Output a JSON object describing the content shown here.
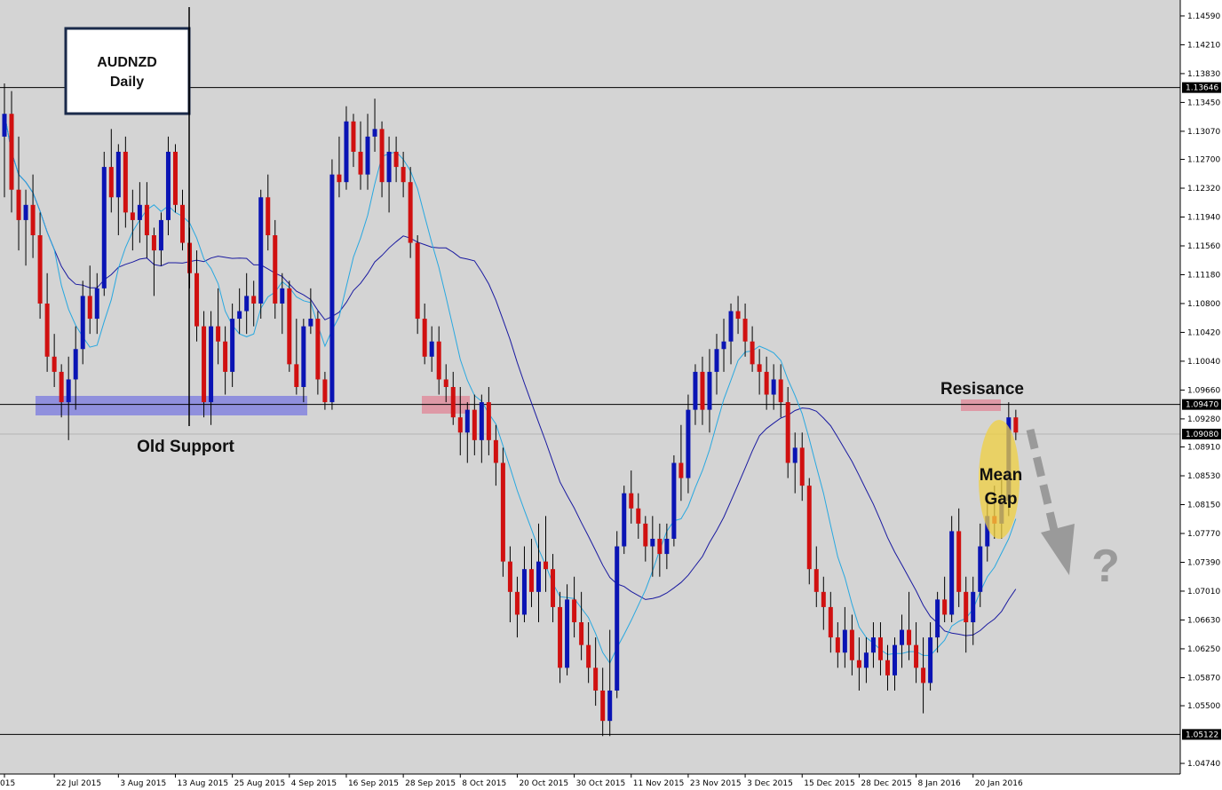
{
  "chart_data": {
    "type": "candlestick",
    "title": "AUDNZD",
    "subtitle": "Daily",
    "ylim": [
      1.046,
      1.148
    ],
    "y_ticks": [
      1.1459,
      1.1421,
      1.1383,
      1.1345,
      1.1307,
      1.127,
      1.1232,
      1.1194,
      1.1156,
      1.1118,
      1.108,
      1.1042,
      1.1004,
      1.0966,
      1.0928,
      1.0891,
      1.0853,
      1.0815,
      1.0777,
      1.0739,
      1.0701,
      1.0663,
      1.0625,
      1.0587,
      1.055,
      1.0474
    ],
    "y_tick_labels": [
      "1.14590",
      "1.14210",
      "1.13830",
      "1.13450",
      "1.13070",
      "1.12700",
      "1.12320",
      "1.11940",
      "1.11560",
      "1.11180",
      "1.10800",
      "1.10420",
      "1.10040",
      "1.09660",
      "1.09280",
      "1.08910",
      "1.08530",
      "1.08150",
      "1.07770",
      "1.07390",
      "1.07010",
      "1.06630",
      "1.06250",
      "1.05870",
      "1.05500",
      "1.04740"
    ],
    "x_labels": [
      {
        "label": "015",
        "bar": 0
      },
      {
        "label": "22 Jul 2015",
        "bar": 7
      },
      {
        "label": "3 Aug 2015",
        "bar": 16
      },
      {
        "label": "13 Aug 2015",
        "bar": 24
      },
      {
        "label": "25 Aug 2015",
        "bar": 32
      },
      {
        "label": "4 Sep 2015",
        "bar": 40
      },
      {
        "label": "16 Sep 2015",
        "bar": 48
      },
      {
        "label": "28 Sep 2015",
        "bar": 56
      },
      {
        "label": "8 Oct 2015",
        "bar": 64
      },
      {
        "label": "20 Oct 2015",
        "bar": 72
      },
      {
        "label": "30 Oct 2015",
        "bar": 80
      },
      {
        "label": "11 Nov 2015",
        "bar": 88
      },
      {
        "label": "23 Nov 2015",
        "bar": 96
      },
      {
        "label": "3 Dec 2015",
        "bar": 104
      },
      {
        "label": "15 Dec 2015",
        "bar": 112
      },
      {
        "label": "28 Dec 2015",
        "bar": 120
      },
      {
        "label": "8 Jan 2016",
        "bar": 128
      },
      {
        "label": "20 Jan 2016",
        "bar": 136
      }
    ],
    "horizontal_lines": [
      {
        "price": 1.13646,
        "label": "1.13646"
      },
      {
        "price": 1.0947,
        "label": "1.09470"
      },
      {
        "price": 1.0908,
        "label": "1.09080"
      },
      {
        "price": 1.05122,
        "label": "1.05122"
      }
    ],
    "bull_color": "#0a14b4",
    "bear_color": "#d01010",
    "ma_fast_color": "#28a8e0",
    "ma_slow_color": "#1a1aa0",
    "ohlc": [
      [
        1.13,
        1.137,
        1.122,
        1.133
      ],
      [
        1.133,
        1.136,
        1.12,
        1.123
      ],
      [
        1.123,
        1.13,
        1.115,
        1.119
      ],
      [
        1.119,
        1.123,
        1.113,
        1.121
      ],
      [
        1.121,
        1.125,
        1.114,
        1.117
      ],
      [
        1.117,
        1.12,
        1.106,
        1.108
      ],
      [
        1.108,
        1.112,
        1.099,
        1.101
      ],
      [
        1.101,
        1.104,
        1.097,
        1.099
      ],
      [
        1.099,
        1.1,
        1.093,
        1.095
      ],
      [
        1.095,
        1.101,
        1.09,
        1.098
      ],
      [
        1.098,
        1.105,
        1.094,
        1.102
      ],
      [
        1.102,
        1.111,
        1.1,
        1.109
      ],
      [
        1.109,
        1.113,
        1.104,
        1.106
      ],
      [
        1.106,
        1.112,
        1.104,
        1.11
      ],
      [
        1.11,
        1.128,
        1.109,
        1.126
      ],
      [
        1.126,
        1.131,
        1.12,
        1.122
      ],
      [
        1.122,
        1.129,
        1.117,
        1.128
      ],
      [
        1.128,
        1.13,
        1.118,
        1.12
      ],
      [
        1.12,
        1.123,
        1.115,
        1.119
      ],
      [
        1.119,
        1.124,
        1.116,
        1.121
      ],
      [
        1.121,
        1.124,
        1.114,
        1.117
      ],
      [
        1.117,
        1.118,
        1.109,
        1.115
      ],
      [
        1.115,
        1.12,
        1.113,
        1.119
      ],
      [
        1.119,
        1.13,
        1.117,
        1.128
      ],
      [
        1.128,
        1.129,
        1.12,
        1.121
      ],
      [
        1.121,
        1.123,
        1.115,
        1.116
      ],
      [
        1.116,
        1.118,
        1.11,
        1.112
      ],
      [
        1.112,
        1.115,
        1.103,
        1.105
      ],
      [
        1.105,
        1.107,
        1.093,
        1.095
      ],
      [
        1.095,
        1.107,
        1.092,
        1.105
      ],
      [
        1.105,
        1.11,
        1.1,
        1.103
      ],
      [
        1.103,
        1.105,
        1.096,
        1.099
      ],
      [
        1.099,
        1.108,
        1.097,
        1.106
      ],
      [
        1.106,
        1.11,
        1.104,
        1.107
      ],
      [
        1.107,
        1.112,
        1.104,
        1.109
      ],
      [
        1.109,
        1.111,
        1.105,
        1.108
      ],
      [
        1.108,
        1.123,
        1.106,
        1.122
      ],
      [
        1.122,
        1.125,
        1.115,
        1.117
      ],
      [
        1.117,
        1.119,
        1.106,
        1.108
      ],
      [
        1.108,
        1.112,
        1.104,
        1.11
      ],
      [
        1.11,
        1.111,
        1.099,
        1.1
      ],
      [
        1.1,
        1.106,
        1.096,
        1.097
      ],
      [
        1.097,
        1.106,
        1.095,
        1.105
      ],
      [
        1.105,
        1.11,
        1.104,
        1.106
      ],
      [
        1.106,
        1.107,
        1.096,
        1.098
      ],
      [
        1.098,
        1.099,
        1.094,
        1.095
      ],
      [
        1.095,
        1.127,
        1.094,
        1.125
      ],
      [
        1.125,
        1.13,
        1.122,
        1.124
      ],
      [
        1.124,
        1.134,
        1.123,
        1.132
      ],
      [
        1.132,
        1.133,
        1.126,
        1.128
      ],
      [
        1.128,
        1.132,
        1.123,
        1.125
      ],
      [
        1.125,
        1.133,
        1.123,
        1.13
      ],
      [
        1.13,
        1.135,
        1.128,
        1.131
      ],
      [
        1.131,
        1.132,
        1.122,
        1.124
      ],
      [
        1.124,
        1.13,
        1.12,
        1.128
      ],
      [
        1.128,
        1.13,
        1.124,
        1.126
      ],
      [
        1.126,
        1.128,
        1.122,
        1.124
      ],
      [
        1.124,
        1.126,
        1.114,
        1.116
      ],
      [
        1.116,
        1.117,
        1.104,
        1.106
      ],
      [
        1.106,
        1.108,
        1.1,
        1.101
      ],
      [
        1.101,
        1.105,
        1.099,
        1.103
      ],
      [
        1.103,
        1.105,
        1.096,
        1.098
      ],
      [
        1.098,
        1.1,
        1.095,
        1.097
      ],
      [
        1.097,
        1.099,
        1.092,
        1.093
      ],
      [
        1.093,
        1.097,
        1.088,
        1.091
      ],
      [
        1.091,
        1.095,
        1.087,
        1.094
      ],
      [
        1.094,
        1.096,
        1.088,
        1.09
      ],
      [
        1.09,
        1.096,
        1.087,
        1.095
      ],
      [
        1.095,
        1.097,
        1.088,
        1.09
      ],
      [
        1.09,
        1.092,
        1.084,
        1.087
      ],
      [
        1.087,
        1.089,
        1.072,
        1.074
      ],
      [
        1.074,
        1.076,
        1.066,
        1.07
      ],
      [
        1.07,
        1.072,
        1.064,
        1.067
      ],
      [
        1.067,
        1.076,
        1.066,
        1.073
      ],
      [
        1.073,
        1.077,
        1.068,
        1.07
      ],
      [
        1.07,
        1.079,
        1.066,
        1.074
      ],
      [
        1.074,
        1.08,
        1.07,
        1.073
      ],
      [
        1.073,
        1.075,
        1.066,
        1.068
      ],
      [
        1.068,
        1.07,
        1.058,
        1.06
      ],
      [
        1.06,
        1.071,
        1.059,
        1.069
      ],
      [
        1.069,
        1.072,
        1.064,
        1.066
      ],
      [
        1.066,
        1.07,
        1.061,
        1.063
      ],
      [
        1.063,
        1.066,
        1.058,
        1.06
      ],
      [
        1.06,
        1.064,
        1.055,
        1.057
      ],
      [
        1.057,
        1.06,
        1.051,
        1.053
      ],
      [
        1.053,
        1.065,
        1.051,
        1.057
      ],
      [
        1.057,
        1.078,
        1.056,
        1.076
      ],
      [
        1.076,
        1.084,
        1.075,
        1.083
      ],
      [
        1.083,
        1.086,
        1.079,
        1.081
      ],
      [
        1.081,
        1.083,
        1.077,
        1.079
      ],
      [
        1.079,
        1.08,
        1.074,
        1.076
      ],
      [
        1.076,
        1.08,
        1.072,
        1.077
      ],
      [
        1.077,
        1.079,
        1.072,
        1.075
      ],
      [
        1.075,
        1.079,
        1.073,
        1.077
      ],
      [
        1.077,
        1.088,
        1.076,
        1.087
      ],
      [
        1.087,
        1.092,
        1.082,
        1.085
      ],
      [
        1.085,
        1.096,
        1.083,
        1.094
      ],
      [
        1.094,
        1.1,
        1.092,
        1.099
      ],
      [
        1.099,
        1.101,
        1.092,
        1.094
      ],
      [
        1.094,
        1.102,
        1.091,
        1.099
      ],
      [
        1.099,
        1.104,
        1.096,
        1.102
      ],
      [
        1.102,
        1.106,
        1.099,
        1.103
      ],
      [
        1.103,
        1.108,
        1.1,
        1.107
      ],
      [
        1.107,
        1.109,
        1.104,
        1.106
      ],
      [
        1.106,
        1.108,
        1.101,
        1.103
      ],
      [
        1.103,
        1.105,
        1.099,
        1.1
      ],
      [
        1.1,
        1.102,
        1.096,
        1.099
      ],
      [
        1.099,
        1.101,
        1.094,
        1.096
      ],
      [
        1.096,
        1.1,
        1.094,
        1.098
      ],
      [
        1.098,
        1.1,
        1.093,
        1.095
      ],
      [
        1.095,
        1.097,
        1.085,
        1.087
      ],
      [
        1.087,
        1.091,
        1.083,
        1.089
      ],
      [
        1.089,
        1.091,
        1.082,
        1.084
      ],
      [
        1.084,
        1.085,
        1.071,
        1.073
      ],
      [
        1.073,
        1.076,
        1.068,
        1.07
      ],
      [
        1.07,
        1.072,
        1.065,
        1.068
      ],
      [
        1.068,
        1.07,
        1.062,
        1.064
      ],
      [
        1.064,
        1.066,
        1.06,
        1.062
      ],
      [
        1.062,
        1.068,
        1.06,
        1.065
      ],
      [
        1.065,
        1.067,
        1.059,
        1.061
      ],
      [
        1.061,
        1.064,
        1.057,
        1.06
      ],
      [
        1.06,
        1.064,
        1.058,
        1.062
      ],
      [
        1.062,
        1.066,
        1.06,
        1.064
      ],
      [
        1.064,
        1.066,
        1.059,
        1.061
      ],
      [
        1.061,
        1.063,
        1.057,
        1.059
      ],
      [
        1.059,
        1.064,
        1.057,
        1.063
      ],
      [
        1.063,
        1.067,
        1.06,
        1.065
      ],
      [
        1.065,
        1.07,
        1.061,
        1.063
      ],
      [
        1.063,
        1.066,
        1.058,
        1.06
      ],
      [
        1.06,
        1.064,
        1.054,
        1.058
      ],
      [
        1.058,
        1.066,
        1.057,
        1.064
      ],
      [
        1.064,
        1.07,
        1.062,
        1.069
      ],
      [
        1.069,
        1.072,
        1.066,
        1.067
      ],
      [
        1.067,
        1.08,
        1.066,
        1.078
      ],
      [
        1.078,
        1.081,
        1.068,
        1.07
      ],
      [
        1.07,
        1.072,
        1.062,
        1.066
      ],
      [
        1.066,
        1.072,
        1.063,
        1.07
      ],
      [
        1.07,
        1.079,
        1.068,
        1.076
      ],
      [
        1.076,
        1.083,
        1.074,
        1.08
      ],
      [
        1.08,
        1.084,
        1.077,
        1.079
      ],
      [
        1.079,
        1.085,
        1.077,
        1.082
      ],
      [
        1.082,
        1.095,
        1.08,
        1.093
      ],
      [
        1.093,
        1.094,
        1.09,
        1.091
      ]
    ]
  },
  "annotations": {
    "title_line1": "AUDNZD",
    "title_line2": "Daily",
    "old_support": "Old Support",
    "resistance": "Resisance",
    "mean": "Mean",
    "gap": "Gap",
    "question": "?"
  },
  "colors": {
    "background": "#d4d4d4",
    "support_zone": "#7a7ae0",
    "resistance_zone": "#e08a9a",
    "mean_gap_ellipse": "#f0d040",
    "arrow": "#9a9a9a"
  }
}
